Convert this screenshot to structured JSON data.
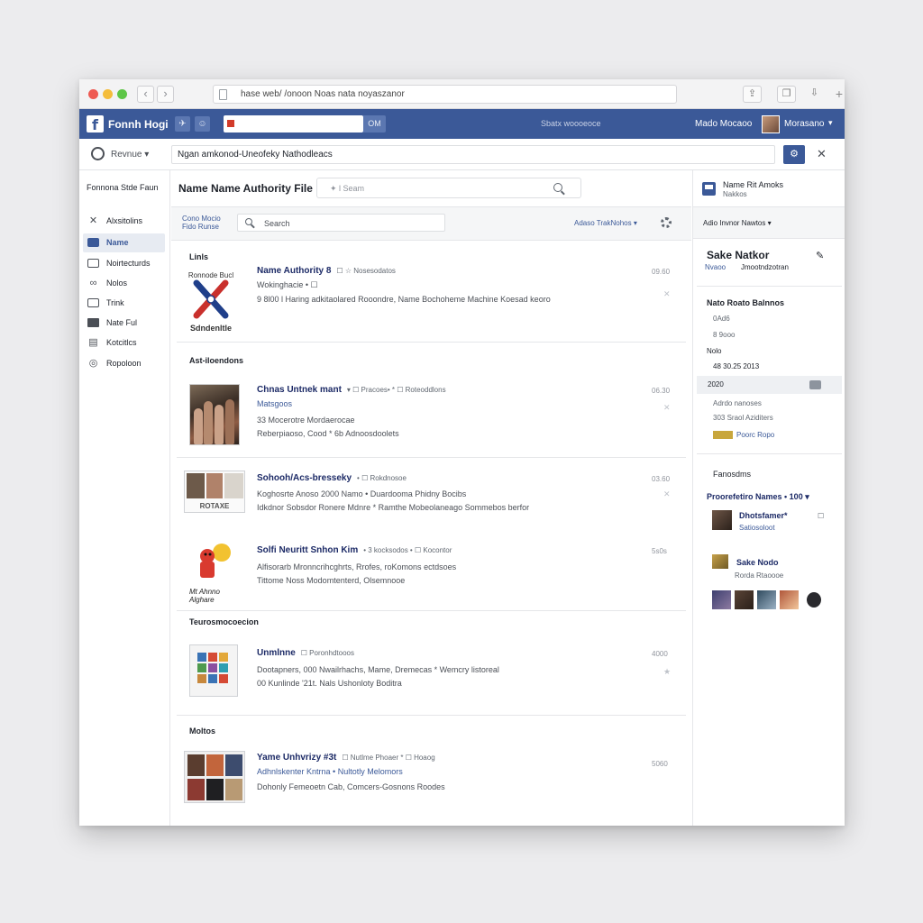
{
  "browser": {
    "url": "hase web/ /onoon Noas nata noyaszanor",
    "back_glyph": "‹",
    "forward_glyph": "›",
    "share_glyph": "⇪",
    "tabs_glyph": "❐",
    "misc_glyph": "⇩",
    "newtab_glyph": "+"
  },
  "topbar": {
    "logo": "f",
    "brand": "Fonnh Hogi",
    "search_button": "OM",
    "center_text": "Sbatx woooeoce",
    "user_name": "Mado Mocaoo",
    "user_name2": "Morasano",
    "caret": "▾",
    "accent": "#3b5998"
  },
  "secondbar": {
    "label": "Revnue",
    "caret": "▾",
    "field_value": "Ngan amkonod-Uneofeky Nathodleacs",
    "close_glyph": "✕"
  },
  "left": {
    "title": "Fonnona Stde Faun",
    "items": [
      {
        "label": "Alxsitolins",
        "icon": "cross-icon"
      },
      {
        "label": "Name",
        "icon": "chat-icon"
      },
      {
        "label": "Noirtecturds",
        "icon": "monitor-icon"
      },
      {
        "label": "Nolos",
        "icon": "link-icon"
      },
      {
        "label": "Trink",
        "icon": "edit-icon"
      },
      {
        "label": "Nate Ful",
        "icon": "grid-icon"
      },
      {
        "label": "Kotcitlcs",
        "icon": "archive-icon"
      },
      {
        "label": "Ropoloon",
        "icon": "globe-icon"
      }
    ]
  },
  "main": {
    "title": "Name Name Authority File",
    "search_placeholder": "✦ l Seam",
    "filter_label": "Cono Mocio Fido Runse",
    "filter_search": "Search",
    "filter_right": "Adaso TrakNohos ▾",
    "sections": [
      {
        "label": "Linls"
      },
      {
        "label": "Ast-iloendons"
      },
      {
        "label": "Teurosmocoecion"
      },
      {
        "label": "Moltos"
      }
    ],
    "items": [
      {
        "title": "Name Authority 8",
        "meta": "☐ ☆ Nosesodatos",
        "line1": "Wokinghacie • ☐",
        "line2": "9 8l00 l Haring adkitaolared Rooondre, Name Bochoheme Machine Koesad keoro",
        "line3": "",
        "right": "09.60",
        "x": "✕",
        "sticker_top": "Ronnode Bucl",
        "sticker_bottom": "Sdndenltle"
      },
      {
        "title": "Chnas Untnek mant",
        "meta": "▾ ☐ Pracoes• * ☐ Roteoddlons",
        "line1": "Matsgoos",
        "line2": "33 Mocerotre Mordaerocae",
        "line3": "Reberpiaoso, Cood * 6b Adnoosdoolets",
        "right": "06.30",
        "x": "✕"
      },
      {
        "title": "Sohooh/Acs-bresseky",
        "meta": "• ☐ Rokdnosoe",
        "line1": "Koghosrte Anoso 2000 Namo • Duardooma Phidny Bocibs",
        "line2": "Idkdnor Sobsdor Ronere Mdnre * Ramthe Mobeolaneago Sommebos berfor",
        "line3": "",
        "right": "03.60",
        "x": "✕",
        "collage_label": "ROTAXE"
      },
      {
        "title": "Solfi Neuritt Snhon Kim",
        "meta": "• 3 kocksodos • ☐ Kocontor",
        "line1": "Alfisorarb Mronncrihcghrts, Rrofes, roKomons ectdsoes",
        "line2": "Tittome Noss Modomtenterd, Olsemnooe",
        "line3": "",
        "right": "5s0s",
        "x": "",
        "sticker_label": "Mt Ahnno Alghare"
      },
      {
        "title": "Unmlnne",
        "meta": "☐ Poronhdtooos",
        "line1": "Dootapners, 000 Nwailrhachs, Mame, Dremecas * Wemcry listoreal",
        "line2": "00 Kunlinde '21t. Nals Ushonloty Boditra",
        "line3": "",
        "right": "4000",
        "x": "★"
      },
      {
        "title": "Yame Unhvrizy #3t",
        "meta": "☐ Nutlme Phoaer * ☐ Hoaog",
        "line1": "Adhnlskenter Kntrna • Nultotly Melomors",
        "line2": "Dohonly Femeoetn Cab, Comcers-Gosnons Roodes",
        "line3": "",
        "right": "5060",
        "x": ""
      }
    ]
  },
  "right": {
    "header_title": "Name Rit Amoks",
    "header_sub": "Nakkos",
    "band_label": "Adio Invnor Nawtos ▾",
    "card_title": "Sake Natkor",
    "card_sub_a": "Nvaoo",
    "card_sub_b": "Jmootndzotran",
    "details_title": "Nato Roato Balnnos",
    "d1": "0Ad6",
    "d2": "8 9ooo",
    "d3": "Nolo",
    "d4": "48 30.25 2013",
    "d5": "2020",
    "d6": "Adrdo nanoses",
    "d7": "303 Sraol Aziditers",
    "d8": "Poorc Ropo",
    "friends_title": "Fanosdms",
    "promo_label": "Proorefetiro Names • 100",
    "promo_caret": "▾",
    "f1_name": "Dhotsfamer",
    "f1_mark": "*",
    "f1_sub": "Satiosoloot",
    "f1_side": "☐",
    "f2_name": "Sake Nodo",
    "f2_sub": "Rorda Rtaoooe"
  }
}
